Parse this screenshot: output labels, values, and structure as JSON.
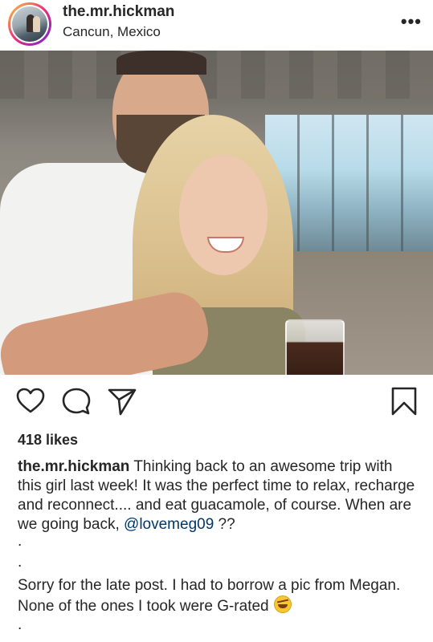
{
  "post": {
    "header": {
      "username": "the.mr.hickman",
      "location": "Cancun, Mexico",
      "more_icon": "•••"
    },
    "actions": {
      "like_icon": "heart-icon",
      "comment_icon": "comment-icon",
      "share_icon": "paper-plane-icon",
      "save_icon": "bookmark-icon"
    },
    "likes": "418 likes",
    "caption": {
      "username": "the.mr.hickman",
      "text": " Thinking back to an awesome trip with this girl last week! It was the perfect time to relax, recharge and reconnect.... and eat guacamole, of course. When are we going back, ",
      "mention": "@lovemeg09",
      "text_end": " ??"
    },
    "dot1": ".",
    "dot2": ".",
    "caption_2": "Sorry for the late post. I had to borrow a pic from Megan. None of the ones I took were G-rated",
    "dot3": "."
  }
}
